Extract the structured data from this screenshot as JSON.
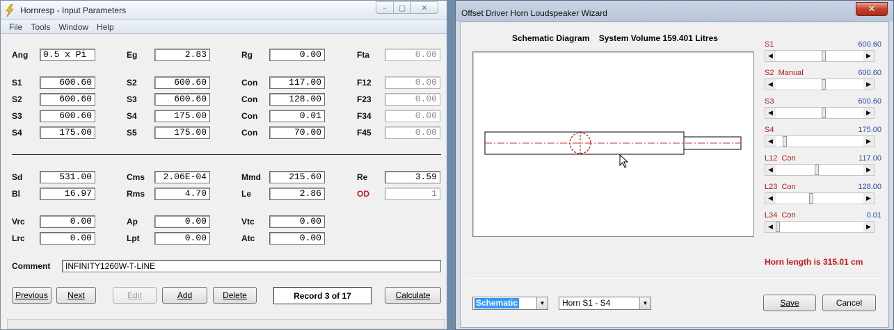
{
  "left_window": {
    "title": "Hornresp - Input Parameters",
    "menu": [
      "File",
      "Tools",
      "Window",
      "Help"
    ],
    "fields": {
      "ang": {
        "label": "Ang",
        "value": "0.5 x Pi"
      },
      "eg": {
        "label": "Eg",
        "value": "2.83"
      },
      "rg": {
        "label": "Rg",
        "value": "0.00"
      },
      "fta": {
        "label": "Fta",
        "value": "0.00"
      },
      "s1": {
        "label": "S1",
        "value": "600.60"
      },
      "s2a": {
        "label": "S2",
        "value": "600.60"
      },
      "con1": {
        "label": "Con",
        "value": "117.00"
      },
      "f12": {
        "label": "F12",
        "value": "0.00"
      },
      "s2b": {
        "label": "S2",
        "value": "600.60"
      },
      "s3a": {
        "label": "S3",
        "value": "600.60"
      },
      "con2": {
        "label": "Con",
        "value": "128.00"
      },
      "f23": {
        "label": "F23",
        "value": "0.00"
      },
      "s3b": {
        "label": "S3",
        "value": "600.60"
      },
      "s4a": {
        "label": "S4",
        "value": "175.00"
      },
      "con3": {
        "label": "Con",
        "value": "0.01"
      },
      "f34": {
        "label": "F34",
        "value": "0.00"
      },
      "s4b": {
        "label": "S4",
        "value": "175.00"
      },
      "s5": {
        "label": "S5",
        "value": "175.00"
      },
      "con4": {
        "label": "Con",
        "value": "70.00"
      },
      "f45": {
        "label": "F45",
        "value": "0.00"
      },
      "sd": {
        "label": "Sd",
        "value": "531.00"
      },
      "cms": {
        "label": "Cms",
        "value": "2.06E-04"
      },
      "mmd": {
        "label": "Mmd",
        "value": "215.60"
      },
      "re": {
        "label": "Re",
        "value": "3.59"
      },
      "bl": {
        "label": "Bl",
        "value": "16.97"
      },
      "rms": {
        "label": "Rms",
        "value": "4.70"
      },
      "le": {
        "label": "Le",
        "value": "2.86"
      },
      "od": {
        "label": "OD",
        "value": "1"
      },
      "vrc": {
        "label": "Vrc",
        "value": "0.00"
      },
      "ap": {
        "label": "Ap",
        "value": "0.00"
      },
      "vtc": {
        "label": "Vtc",
        "value": "0.00"
      },
      "lrc": {
        "label": "Lrc",
        "value": "0.00"
      },
      "lpt": {
        "label": "Lpt",
        "value": "0.00"
      },
      "atc": {
        "label": "Atc",
        "value": "0.00"
      }
    },
    "comment": {
      "label": "Comment",
      "value": "INFINITY1260W-T-LINE"
    },
    "buttons": {
      "previous": "Previous",
      "next": "Next",
      "edit": "Edit",
      "add": "Add",
      "delete": "Delete",
      "calculate": "Calculate"
    },
    "record": "Record 3 of 17"
  },
  "right_window": {
    "title": "Offset Driver Horn Loudspeaker Wizard",
    "close_glyph": "✕",
    "schematic_title": "Schematic Diagram    System Volume 159.401 Litres",
    "sliders": [
      {
        "label": "S1",
        "value": "600.60",
        "position": 0.55
      },
      {
        "label": "S2  Manual",
        "value": "600.60",
        "position": 0.55
      },
      {
        "label": "S3",
        "value": "600.60",
        "position": 0.55
      },
      {
        "label": "S4",
        "value": "175.00",
        "position": 0.08
      },
      {
        "label": "L12  Con",
        "value": "117.00",
        "position": 0.47
      },
      {
        "label": "L23  Con",
        "value": "128.00",
        "position": 0.4
      },
      {
        "label": "L34  Con",
        "value": "0.01",
        "position": 0.0
      }
    ],
    "horn_length": "Horn length is 315.01 cm",
    "view_select": "Schematic",
    "segment_select": "Horn S1 - S4",
    "buttons": {
      "save": "Save",
      "cancel": "Cancel"
    }
  },
  "colors": {
    "label_red": "#c8181a",
    "value_blue": "#2a4aa6",
    "selection_blue": "#3399ff",
    "close_red": "#c0402d"
  }
}
